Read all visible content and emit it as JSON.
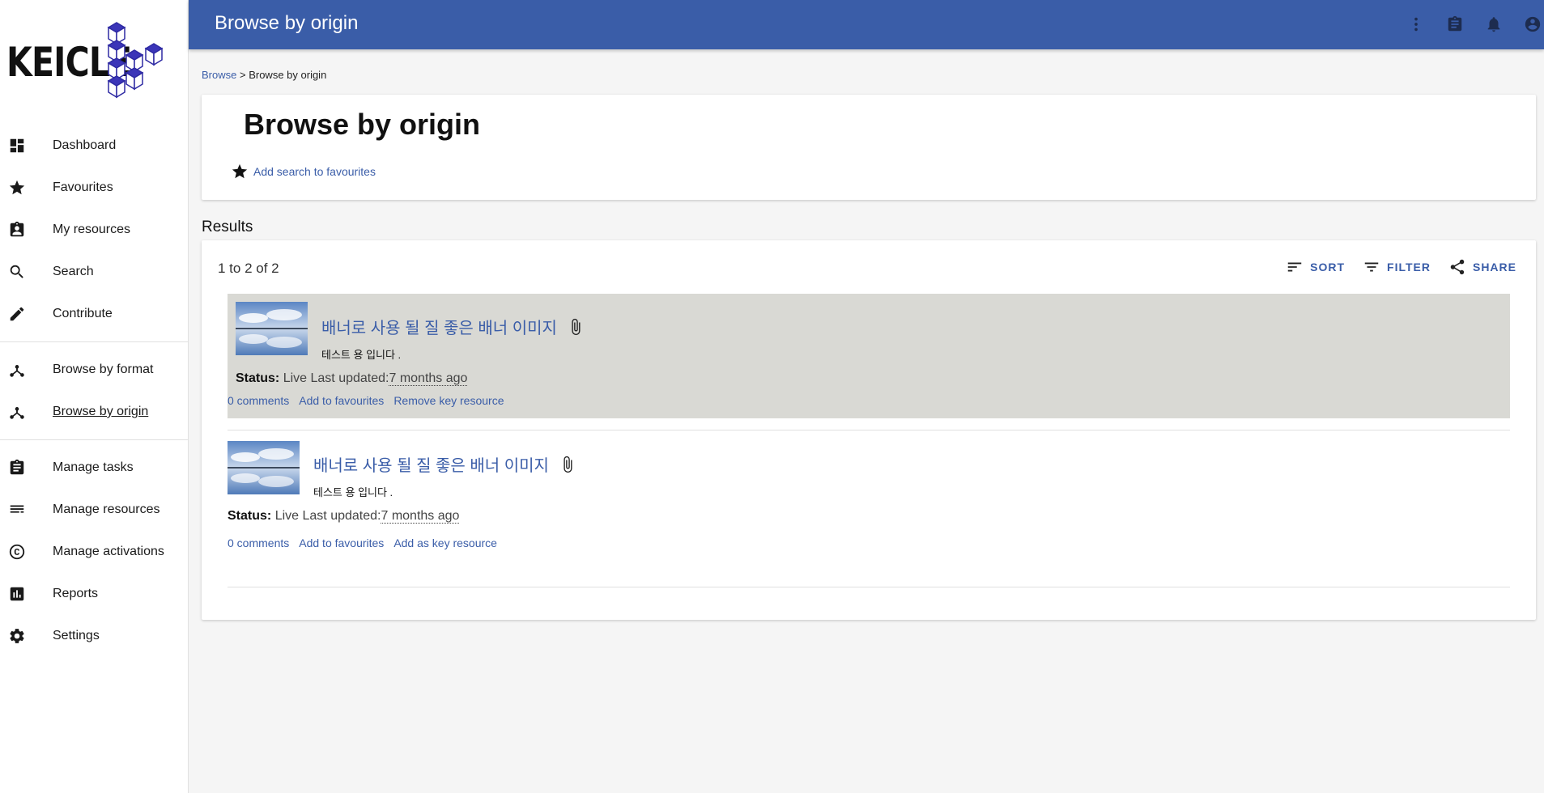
{
  "app": {
    "logo_text": "KEICLE"
  },
  "header": {
    "title": "Browse by origin"
  },
  "sidebar": {
    "items": [
      {
        "label": "Dashboard",
        "icon": "dashboard-icon"
      },
      {
        "label": "Favourites",
        "icon": "star-icon"
      },
      {
        "label": "My resources",
        "icon": "account-box-icon"
      },
      {
        "label": "Search",
        "icon": "search-icon"
      },
      {
        "label": "Contribute",
        "icon": "pencil-icon"
      },
      {
        "label": "Browse by format",
        "icon": "hierarchy-icon"
      },
      {
        "label": "Browse by origin",
        "icon": "hierarchy-icon"
      },
      {
        "label": "Manage tasks",
        "icon": "clipboard-icon"
      },
      {
        "label": "Manage resources",
        "icon": "list-icon"
      },
      {
        "label": "Manage activations",
        "icon": "copyright-icon"
      },
      {
        "label": "Reports",
        "icon": "chart-icon"
      },
      {
        "label": "Settings",
        "icon": "gear-icon"
      }
    ]
  },
  "breadcrumb": {
    "link": "Browse",
    "separator": ">",
    "current": "Browse by origin"
  },
  "page": {
    "title": "Browse by origin",
    "favourite_link": "Add search to favourites"
  },
  "results": {
    "heading": "Results",
    "count": "1 to 2 of 2",
    "sort_label": "SORT",
    "filter_label": "FILTER",
    "share_label": "SHARE",
    "items": [
      {
        "title": "배너로 사용 될 질 좋은 배너 이미지",
        "description": "테스트 용 입니다 .",
        "status_label": "Status:",
        "status_value": "Live",
        "updated_label": "Last updated:",
        "updated_value": "7 months ago",
        "comments": "0 comments",
        "favourite": "Add to favourites",
        "key_resource": "Remove key resource"
      },
      {
        "title": "배너로 사용 될 질 좋은 배너 이미지",
        "description": "테스트 용 입니다 .",
        "status_label": "Status:",
        "status_value": "Live",
        "updated_label": "Last updated:",
        "updated_value": "7 months ago",
        "comments": "0 comments",
        "favourite": "Add to favourites",
        "key_resource": "Add as key resource"
      }
    ]
  },
  "colors": {
    "primary": "#3a5da8",
    "highlight_row": "#d9d9d4"
  }
}
